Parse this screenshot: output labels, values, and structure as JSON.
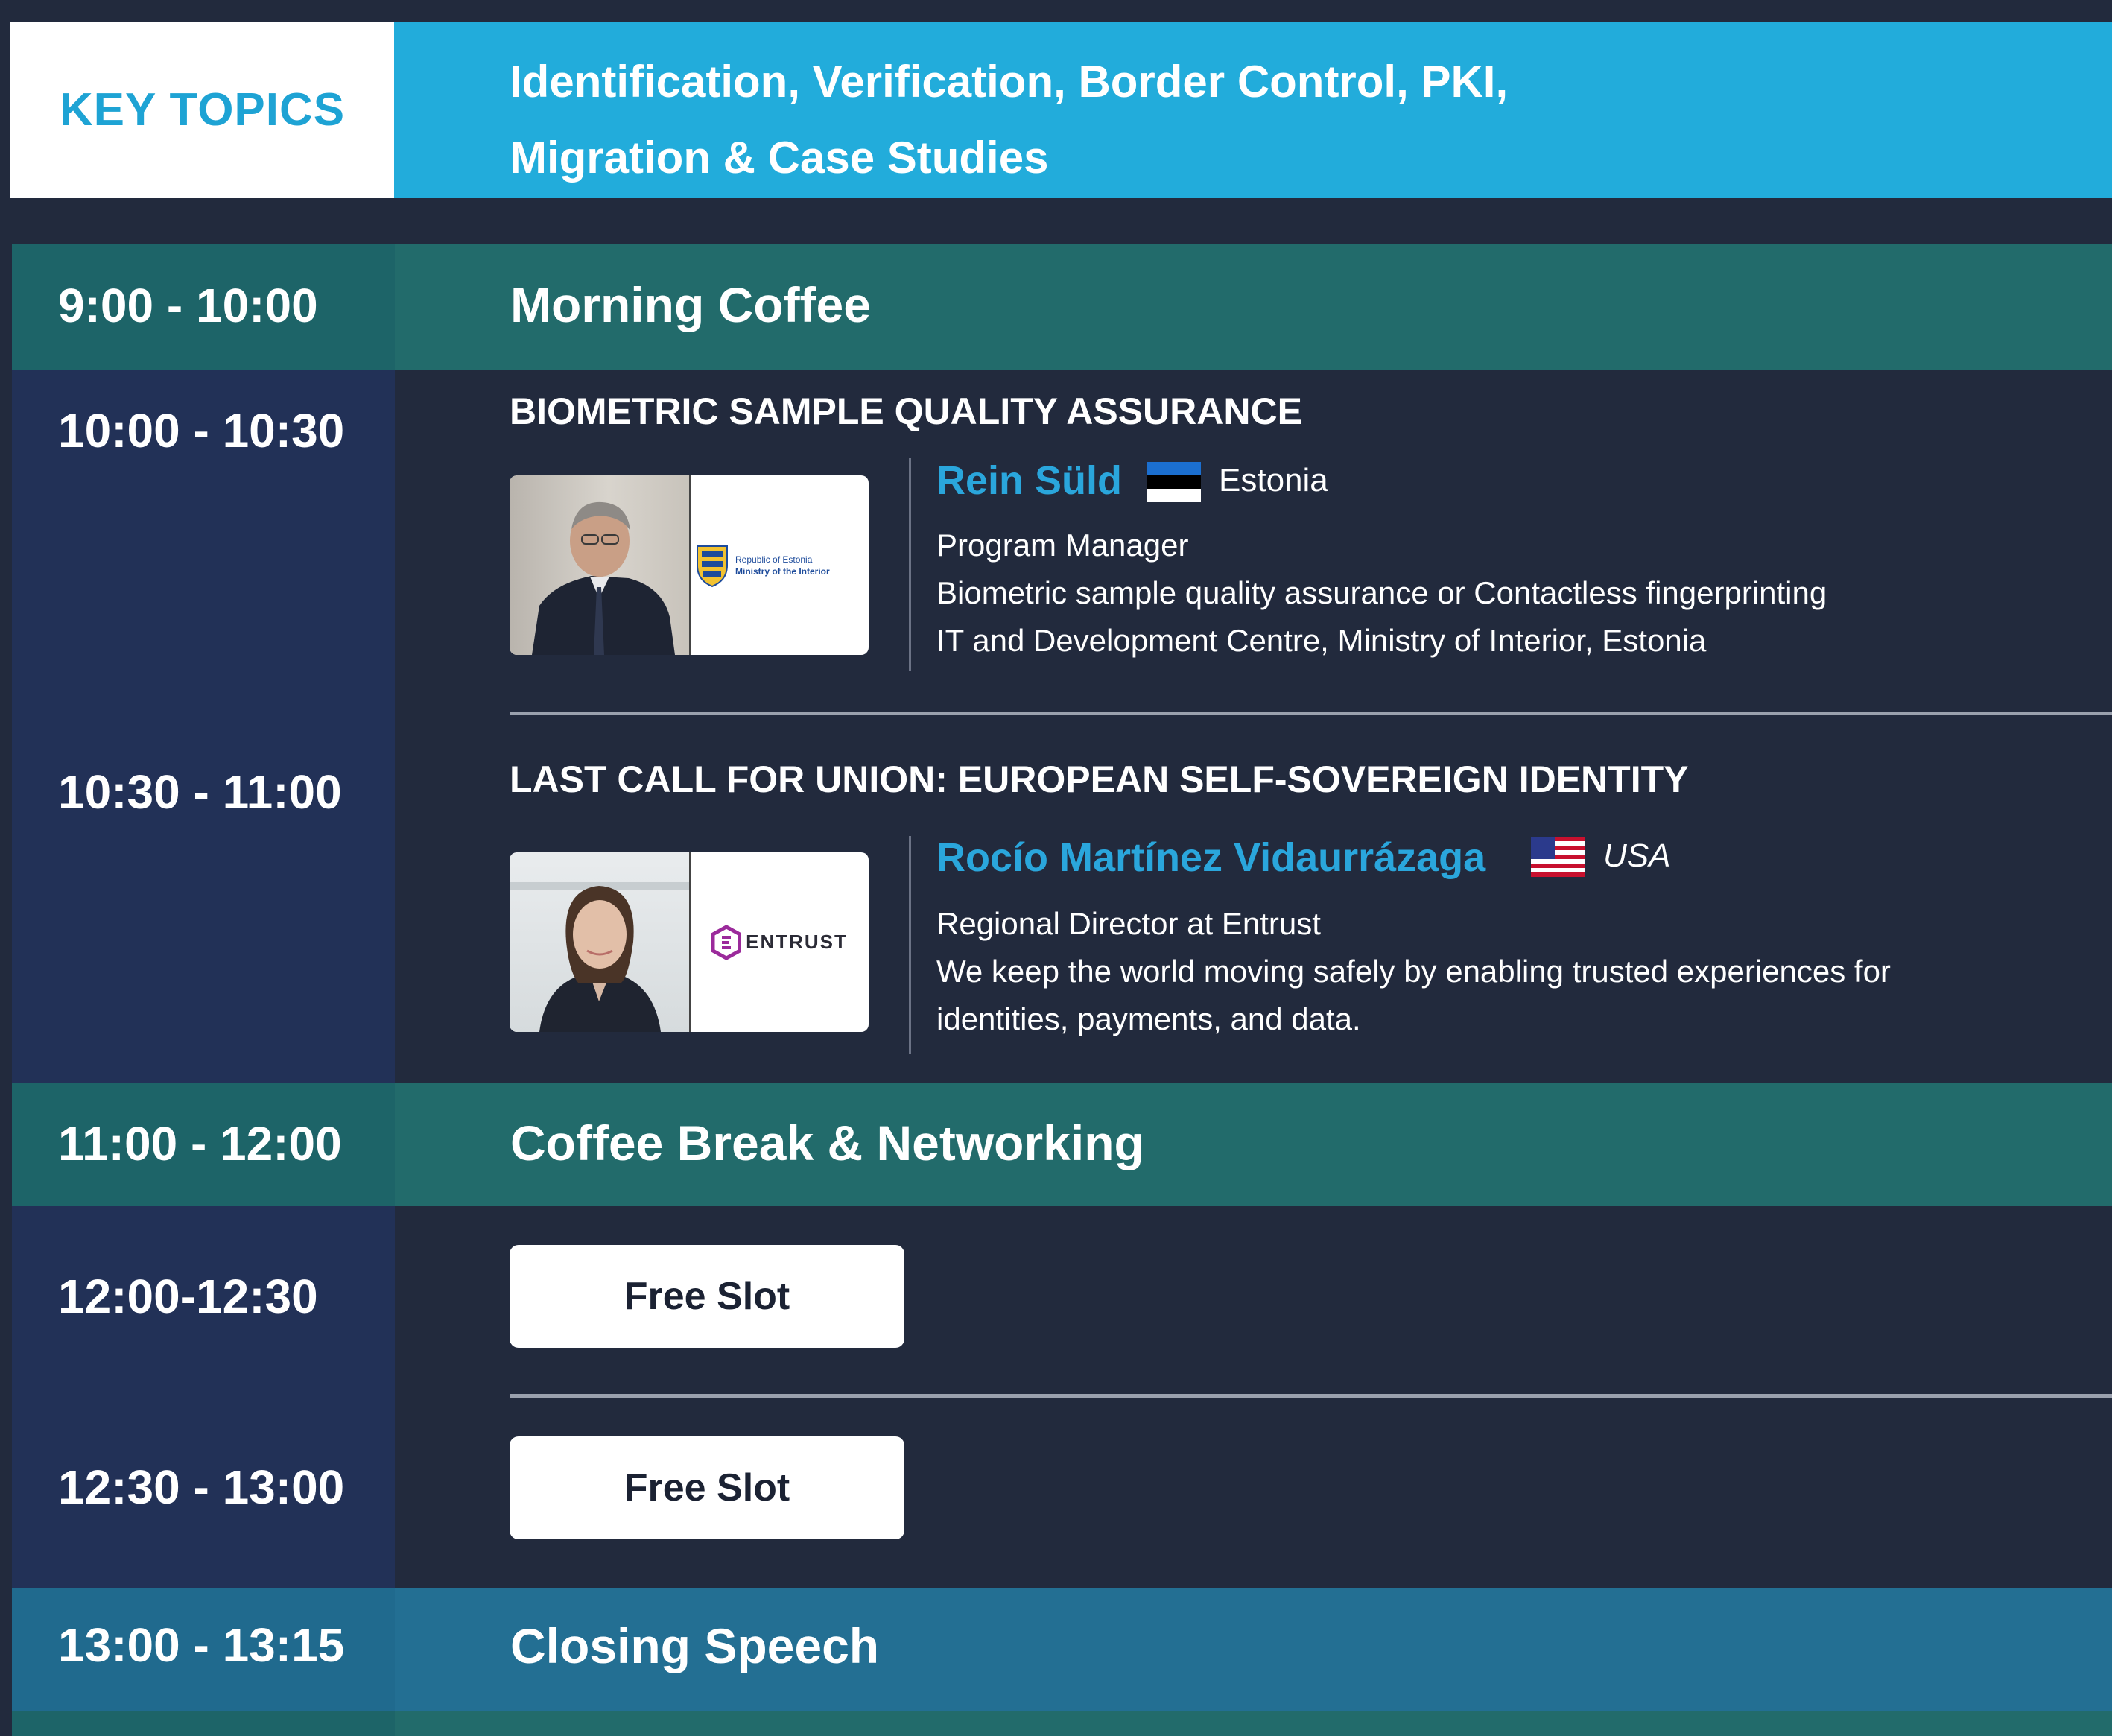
{
  "key_topics": {
    "label": "KEY TOPICS",
    "line1": "Identification, Verification, Border Control, PKI,",
    "line2": "Migration & Case Studies"
  },
  "schedule": {
    "morning_coffee": {
      "time": "9:00 - 10:00",
      "title": "Morning Coffee"
    },
    "session1": {
      "time": "10:00 - 10:30",
      "title": "BIOMETRIC SAMPLE QUALITY ASSURANCE",
      "speaker": "Rein Süld",
      "country": "Estonia",
      "role": "Program Manager",
      "topic": "Biometric sample quality assurance or Contactless fingerprinting",
      "org": "IT and Development Centre, Ministry of Interior, Estonia",
      "logo_line1": "Republic of Estonia",
      "logo_line2": "Ministry of the Interior"
    },
    "session2": {
      "time": "10:30 - 11:00",
      "title": "LAST CALL FOR UNION: EUROPEAN SELF-SOVEREIGN IDENTITY",
      "speaker": "Rocío Martínez Vidaurrázaga",
      "country": "USA",
      "role": "Regional Director  at Entrust",
      "desc1": "We keep the world moving safely by enabling trusted experiences for",
      "desc2": "identities, payments, and data.",
      "logo_text": "ENTRUST"
    },
    "coffee_break": {
      "time": "11:00 - 12:00",
      "title": "Coffee Break & Networking"
    },
    "slot1": {
      "time": "12:00-12:30",
      "button": "Free Slot"
    },
    "slot2": {
      "time": "12:30 - 13:00",
      "button": "Free Slot"
    },
    "closing": {
      "time": "13:00 - 13:15",
      "title": "Closing Speech"
    }
  },
  "colors": {
    "background": "#222a3d",
    "accent_blue": "#22acdb",
    "teal_row": "#226b6b",
    "navy_time": "#223157",
    "speaker_name": "#2aa6dc"
  },
  "icons": [
    "estonia-flag-icon",
    "usa-flag-icon",
    "estonia-coat-of-arms-icon",
    "entrust-logo-icon"
  ]
}
